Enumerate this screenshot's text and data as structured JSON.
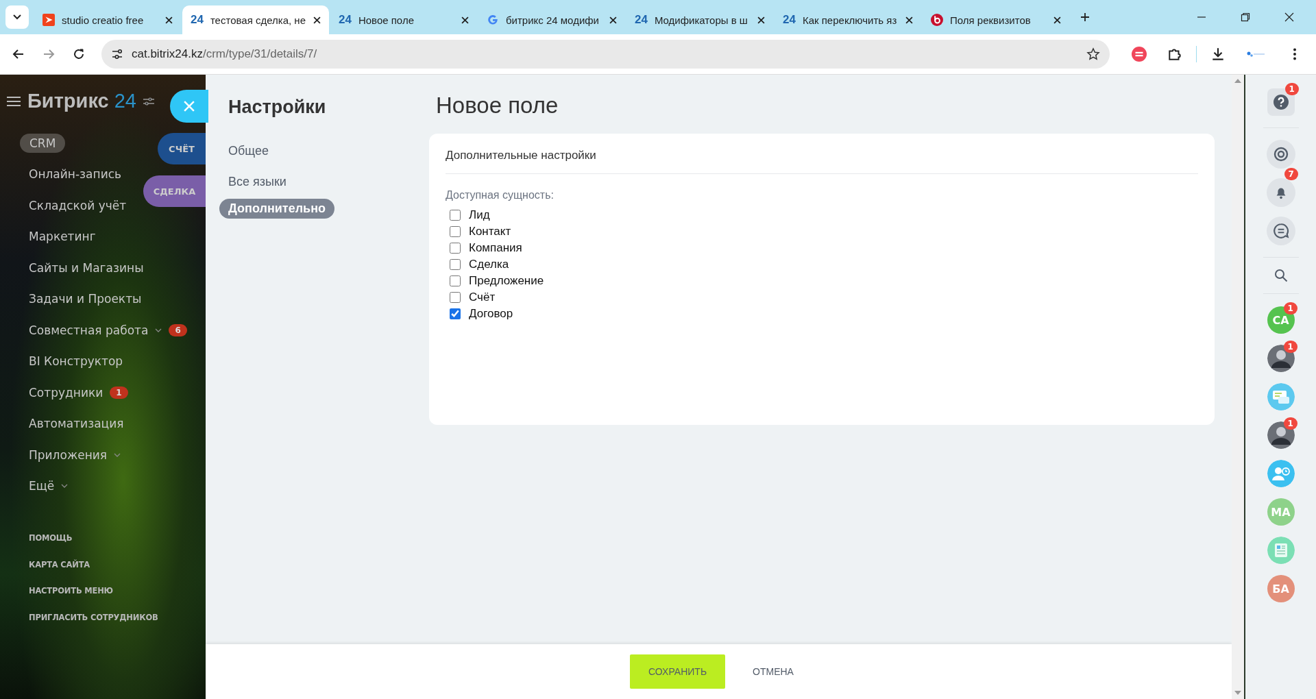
{
  "browser": {
    "tabs": [
      {
        "title": "studio creatio free",
        "kind": "creatio",
        "selected": false
      },
      {
        "title": "тестовая сделка, не",
        "kind": "bitrix",
        "icon_text": "24",
        "selected": true
      },
      {
        "title": "Новое поле",
        "kind": "bitrix",
        "icon_text": "24",
        "selected": false
      },
      {
        "title": "битрикс 24 модифи",
        "kind": "google",
        "selected": false
      },
      {
        "title": "Модификаторы в ш",
        "kind": "bitrix",
        "icon_text": "24",
        "selected": false
      },
      {
        "title": "Как переключить яз",
        "kind": "bitrix",
        "icon_text": "24",
        "selected": false
      },
      {
        "title": "Поля реквизитов",
        "kind": "red-b",
        "selected": false
      }
    ],
    "url": {
      "host": "cat.bitrix24.kz",
      "path": "/crm/type/31/details/7/"
    }
  },
  "sidebar": {
    "logo": {
      "name": "Битрикс",
      "number": "24"
    },
    "items": [
      {
        "label": "CRM",
        "selected": true,
        "expandable": false
      },
      {
        "label": "Онлайн-запись",
        "selected": false,
        "expandable": false
      },
      {
        "label": "Складской учёт",
        "selected": false,
        "expandable": false
      },
      {
        "label": "Маркетинг",
        "selected": false,
        "expandable": false
      },
      {
        "label": "Сайты и Магазины",
        "selected": false,
        "expandable": false
      },
      {
        "label": "Задачи и Проекты",
        "selected": false,
        "expandable": false
      },
      {
        "label": "Совместная работа",
        "selected": false,
        "expandable": true,
        "counter": "6"
      },
      {
        "label": "BI Конструктор",
        "selected": false,
        "expandable": false
      },
      {
        "label": "Сотрудники",
        "selected": false,
        "expandable": false,
        "counter": "1"
      },
      {
        "label": "Автоматизация",
        "selected": false,
        "expandable": false
      },
      {
        "label": "Приложения",
        "selected": false,
        "expandable": true
      },
      {
        "label": "Ещё",
        "selected": false,
        "expandable": true
      }
    ],
    "footer_links": [
      "ПОМОЩЬ",
      "КАРТА САЙТА",
      "НАСТРОИТЬ МЕНЮ",
      "ПРИГЛАСИТЬ СОТРУДНИКОВ"
    ]
  },
  "slider_stack": [
    {
      "label": "СЧЁТ",
      "color": "#1d4f8e"
    },
    {
      "label": "СДЕЛКА",
      "color": "#7a5ea8"
    }
  ],
  "settings": {
    "title": "Настройки",
    "nav": [
      {
        "label": "Общее",
        "selected": false
      },
      {
        "label": "Все языки",
        "selected": false
      },
      {
        "label": "Дополнительно",
        "selected": true
      }
    ]
  },
  "page_title": "Новое поле",
  "card": {
    "heading": "Дополнительные настройки",
    "field_label": "Доступная сущность:",
    "options": [
      {
        "label": "Лид",
        "checked": false
      },
      {
        "label": "Контакт",
        "checked": false
      },
      {
        "label": "Компания",
        "checked": false
      },
      {
        "label": "Сделка",
        "checked": false
      },
      {
        "label": "Предложение",
        "checked": false
      },
      {
        "label": "Счёт",
        "checked": false
      },
      {
        "label": "Договор",
        "checked": true
      }
    ]
  },
  "footer": {
    "save": "СОХРАНИТЬ",
    "cancel": "ОТМЕНА"
  },
  "right_bar": {
    "tools": [
      {
        "kind": "help",
        "badge": "1"
      },
      {
        "kind": "copilot"
      },
      {
        "kind": "bell",
        "badge": "7"
      },
      {
        "kind": "chat-list"
      },
      {
        "kind": "search"
      }
    ],
    "contacts": [
      {
        "kind": "initials",
        "initials": "СА",
        "color": "#55c34f",
        "badge": "1"
      },
      {
        "kind": "photo",
        "badge": "1"
      },
      {
        "kind": "chat"
      },
      {
        "kind": "photo",
        "badge": "1"
      },
      {
        "kind": "user-clock"
      },
      {
        "kind": "initials",
        "initials": "МА",
        "color": "#8ed28a"
      },
      {
        "kind": "news"
      },
      {
        "kind": "initials",
        "initials": "БА",
        "color": "#e3907a"
      }
    ]
  }
}
